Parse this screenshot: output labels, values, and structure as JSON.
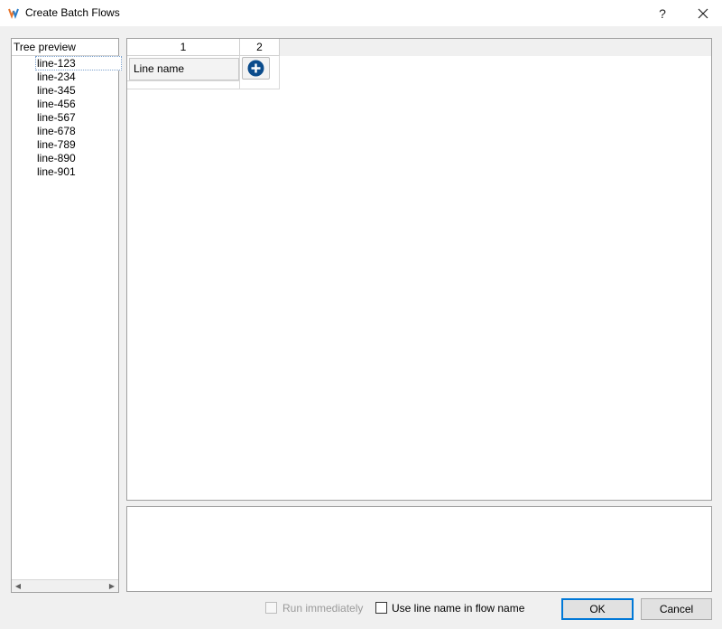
{
  "window": {
    "title": "Create Batch Flows",
    "help_label": "?",
    "close_icon": "close-icon",
    "app_icon": "app-logo-icon"
  },
  "tree": {
    "header": "Tree preview",
    "items": [
      "line-123",
      "line-234",
      "line-345",
      "line-456",
      "line-567",
      "line-678",
      "line-789",
      "line-890",
      "line-901"
    ],
    "selected_index": 0
  },
  "grid": {
    "columns": [
      "1",
      "2"
    ],
    "row": {
      "name_button_label": "Line name",
      "add_icon": "plus-circle-icon"
    }
  },
  "footer": {
    "run_immediately_label": "Run immediately",
    "run_immediately_checked": false,
    "run_immediately_enabled": false,
    "use_line_name_label": "Use line name in flow name",
    "use_line_name_checked": false,
    "ok_label": "OK",
    "cancel_label": "Cancel"
  },
  "colors": {
    "accent": "#0078d7",
    "add_button": "#0b4c8c"
  }
}
